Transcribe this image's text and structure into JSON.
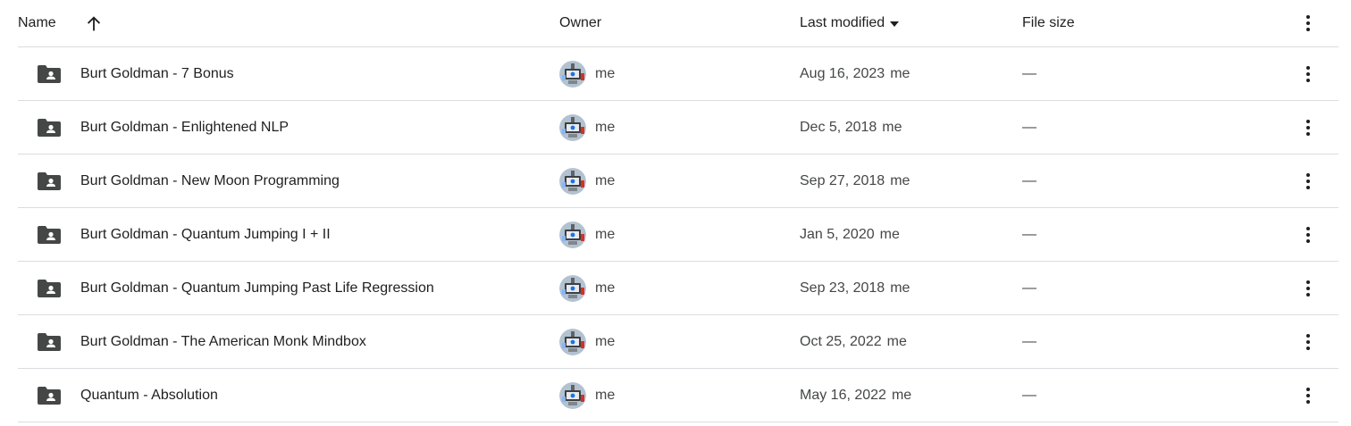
{
  "columns": {
    "name": "Name",
    "owner": "Owner",
    "last_modified": "Last modified",
    "file_size": "File size"
  },
  "icons": {
    "sort": "arrow-up-icon",
    "sort_menu": "caret-down-icon",
    "more": "more-vert-icon",
    "folder": "shared-folder-icon",
    "avatar": "user-avatar"
  },
  "colors": {
    "folder": "#444746",
    "divider": "#dadce0",
    "text": "#1f1f1f",
    "secondary_text": "#444746"
  },
  "rows": [
    {
      "name": "Burt Goldman - 7 Bonus",
      "owner": "me",
      "date": "Aug 16, 2023",
      "modified_by": "me",
      "size": "—"
    },
    {
      "name": "Burt Goldman - Enlightened NLP",
      "owner": "me",
      "date": "Dec 5, 2018",
      "modified_by": "me",
      "size": "—"
    },
    {
      "name": "Burt Goldman - New Moon Programming",
      "owner": "me",
      "date": "Sep 27, 2018",
      "modified_by": "me",
      "size": "—"
    },
    {
      "name": "Burt Goldman - Quantum Jumping I + II",
      "owner": "me",
      "date": "Jan 5, 2020",
      "modified_by": "me",
      "size": "—"
    },
    {
      "name": "Burt Goldman - Quantum Jumping Past Life Regression",
      "owner": "me",
      "date": "Sep 23, 2018",
      "modified_by": "me",
      "size": "—"
    },
    {
      "name": "Burt Goldman - The American Monk Mindbox",
      "owner": "me",
      "date": "Oct 25, 2022",
      "modified_by": "me",
      "size": "—"
    },
    {
      "name": "Quantum - Absolution",
      "owner": "me",
      "date": "May 16, 2022",
      "modified_by": "me",
      "size": "—"
    }
  ]
}
